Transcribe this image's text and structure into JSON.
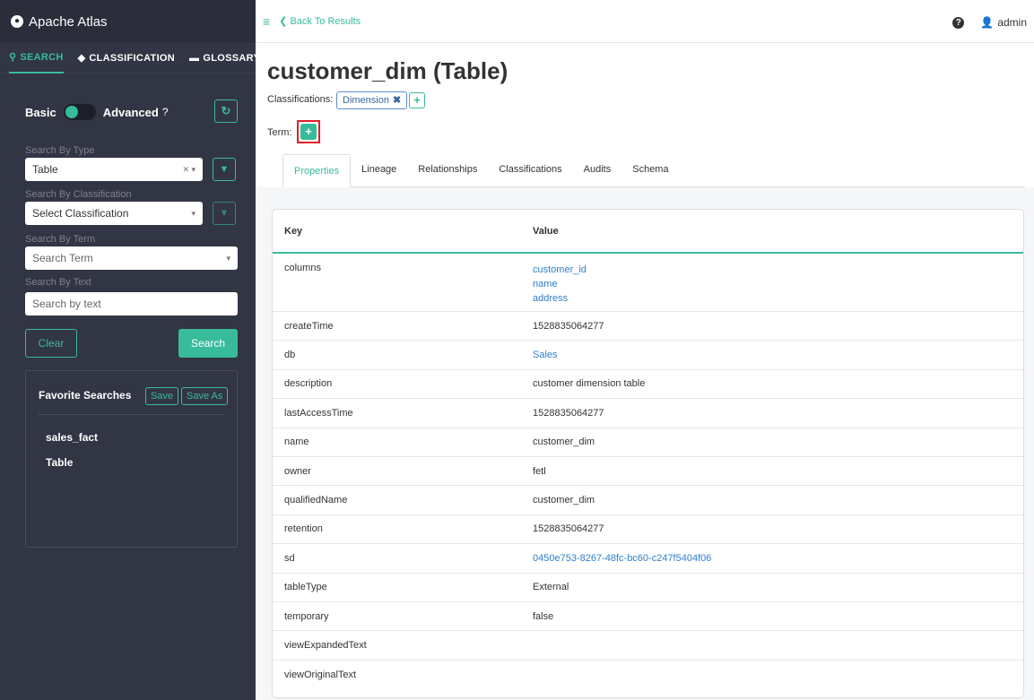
{
  "sidebar": {
    "brand": "Apache Atlas",
    "tabs": [
      {
        "label": "SEARCH",
        "icon": "search-icon"
      },
      {
        "label": "CLASSIFICATION",
        "icon": "tag-icon"
      },
      {
        "label": "GLOSSARY",
        "icon": "folder-icon"
      }
    ],
    "basic_label": "Basic",
    "advanced_label": "Advanced",
    "advanced_help": "?",
    "type_label": "Search By Type",
    "type_value": "Table",
    "classification_label": "Search By Classification",
    "classification_placeholder": "Select Classification",
    "term_label": "Search By Term",
    "term_placeholder": "Search Term",
    "text_label": "Search By Text",
    "text_placeholder": "Search by text",
    "clear_label": "Clear",
    "search_label": "Search",
    "favorites": {
      "title": "Favorite Searches",
      "save_label": "Save",
      "save_as_label": "Save As",
      "items": [
        "sales_fact",
        "Table"
      ]
    }
  },
  "topbar": {
    "back_label": "Back To Results",
    "user": "admin"
  },
  "entity": {
    "title": "customer_dim (Table)",
    "classifications_label": "Classifications:",
    "classification_tag": "Dimension",
    "term_label": "Term:"
  },
  "tabs": [
    "Properties",
    "Lineage",
    "Relationships",
    "Classifications",
    "Audits",
    "Schema"
  ],
  "table": {
    "headers": {
      "key": "Key",
      "value": "Value"
    },
    "rows": [
      {
        "key": "columns",
        "values": [
          "customer_id",
          "name",
          "address"
        ],
        "link": true
      },
      {
        "key": "createTime",
        "value": "1528835064277"
      },
      {
        "key": "db",
        "value": "Sales",
        "link": true
      },
      {
        "key": "description",
        "value": "customer dimension table"
      },
      {
        "key": "lastAccessTime",
        "value": "1528835064277"
      },
      {
        "key": "name",
        "value": "customer_dim"
      },
      {
        "key": "owner",
        "value": "fetl"
      },
      {
        "key": "qualifiedName",
        "value": "customer_dim"
      },
      {
        "key": "retention",
        "value": "1528835064277"
      },
      {
        "key": "sd",
        "value": "0450e753-8267-48fc-bc60-c247f5404f06",
        "link": true
      },
      {
        "key": "tableType",
        "value": "External"
      },
      {
        "key": "temporary",
        "value": "false"
      },
      {
        "key": "viewExpandedText",
        "value": ""
      },
      {
        "key": "viewOriginalText",
        "value": ""
      }
    ]
  },
  "colors": {
    "accent": "#38bb9b",
    "sidebar": "#323544",
    "link": "#2f7fcb",
    "highlight": "#e01e2b"
  }
}
